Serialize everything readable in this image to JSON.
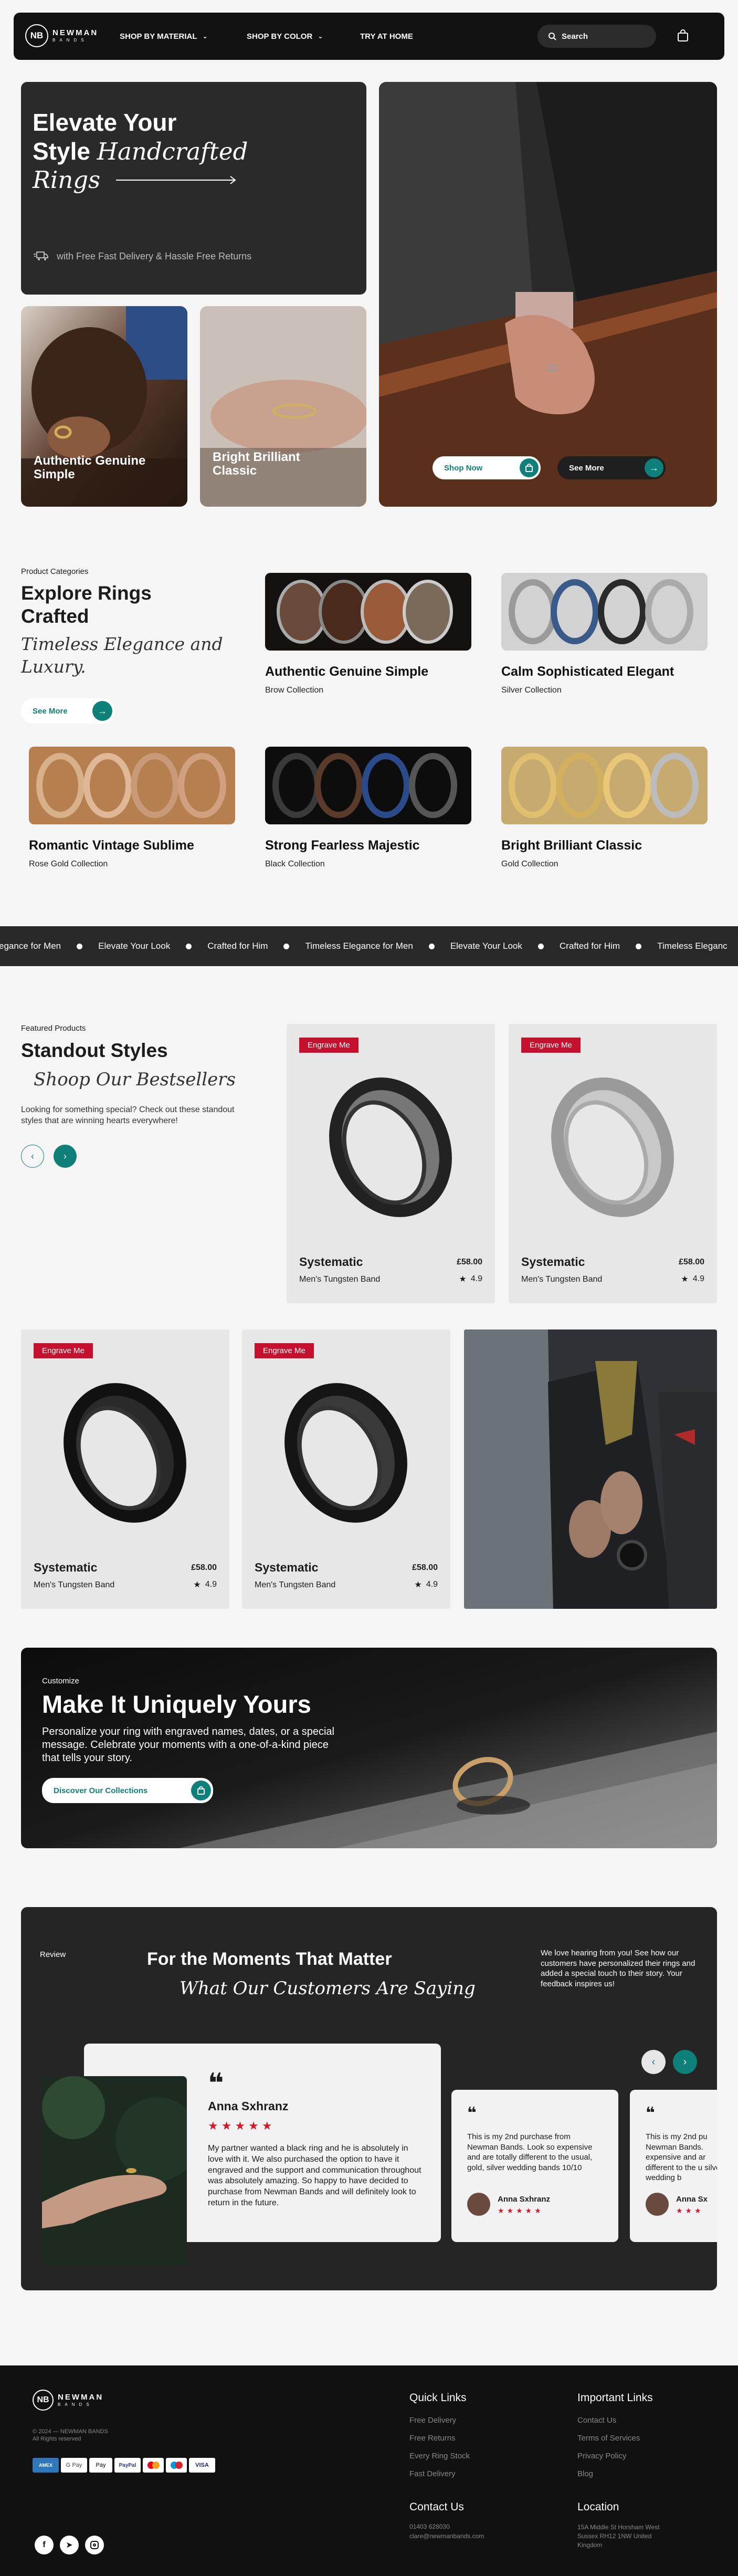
{
  "header": {
    "brand_initials": "NB",
    "brand_name": "NEWMAN",
    "brand_sub": "BANDS",
    "nav": [
      "SHOP BY MATERIAL",
      "SHOP BY COLOR",
      "TRY AT HOME"
    ],
    "search_placeholder": "Search"
  },
  "hero": {
    "title_line1": "Elevate Your",
    "title_line2_bold": "Style",
    "title_line2_italic": "Handcrafted",
    "title_line3_italic": "Rings",
    "delivery_text": "with Free Fast Delivery & Hassle Free Returns",
    "card1_label": "Authentic Genuine Simple",
    "card2_label": "Bright Brilliant Classic",
    "shop_now": "Shop Now",
    "see_more": "See More"
  },
  "categories": {
    "eyebrow": "Product Categories",
    "title": "Explore Rings Crafted",
    "subtitle": "Timeless Elegance and Luxury.",
    "see_more": "See More",
    "items": [
      {
        "title": "Authentic Genuine Simple",
        "sub": "Brow Collection"
      },
      {
        "title": "Calm Sophisticated Elegant",
        "sub": "Silver Collection"
      },
      {
        "title": "Romantic Vintage Sublime",
        "sub": "Rose Gold Collection"
      },
      {
        "title": "Strong Fearless Majestic",
        "sub": "Black Collection"
      },
      {
        "title": "Bright Brilliant Classic",
        "sub": "Gold Collection"
      }
    ]
  },
  "marquee": [
    "egance for Men",
    "Elevate Your Look",
    "Crafted for Him",
    "Timeless Elegance for Men",
    "Elevate Your Look",
    "Crafted for Him",
    "Timeless Eleganc"
  ],
  "featured": {
    "eyebrow": "Featured Products",
    "title": "Standout Styles",
    "subtitle": "Shoop Our Bestsellers",
    "description": "Looking for something special? Check out these standout styles that are winning hearts everywhere!",
    "products": [
      {
        "badge": "Engrave Me",
        "name": "Systematic",
        "price": "£58.00",
        "type": "Men's Tungsten Band",
        "rating": "4.9"
      },
      {
        "badge": "Engrave Me",
        "name": "Systematic",
        "price": "£58.00",
        "type": "Men's Tungsten Band",
        "rating": "4.9"
      },
      {
        "badge": "Engrave Me",
        "name": "Systematic",
        "price": "£58.00",
        "type": "Men's Tungsten Band",
        "rating": "4.9"
      },
      {
        "badge": "Engrave Me",
        "name": "Systematic",
        "price": "£58.00",
        "type": "Men's Tungsten Band",
        "rating": "4.9"
      }
    ]
  },
  "customize": {
    "eyebrow": "Customize",
    "title": "Make It Uniquely Yours",
    "text": "Personalize your ring with engraved names, dates, or a special message. Celebrate your moments with a one-of-a-kind piece that tells your story.",
    "button": "Discover Our Collections"
  },
  "reviews": {
    "eyebrow": "Review",
    "title": "For the Moments That Matter",
    "subtitle": "What Our Customers Are Saying",
    "intro": "We love hearing from you! See how our customers have personalized their rings and added a special touch to their story. Your feedback inspires us!",
    "main": {
      "name": "Anna Sxhranz",
      "stars": "★★★★★",
      "text": "My partner wanted a black ring and he is absolutely in love with it. We also purchased the option to have it engraved and the support and communication throughout was absolutely amazing. So happy to have decided to purchase from Newman Bands and will definitely look to return in the future."
    },
    "small1": {
      "text": "This is my 2nd purchase from Newman Bands. Look so expensive and are totally different to the usual, gold, silver wedding bands 10/10",
      "name": "Anna Sxhranz",
      "stars": "★★★★★"
    },
    "small2": {
      "text": "This is my 2nd pu Newman Bands. expensive and ar different to the u silver wedding b",
      "name": "Anna Sx",
      "stars": "★★★"
    }
  },
  "footer": {
    "brand_initials": "NB",
    "brand_name": "NEWMAN",
    "brand_sub": "BANDS",
    "copyright": "© 2024 — NEWMAN BANDS",
    "rights": "All Rights reserved",
    "payments": [
      "AMEX",
      "G Pay",
      "Pay",
      "PayPal",
      "",
      "",
      "VISA"
    ],
    "quick_links_title": "Quick Links",
    "quick_links": [
      "Free Delivery",
      "Free Returns",
      "Every Ring Stock",
      "Fast Delivery"
    ],
    "important_title": "Important Links",
    "important_links": [
      "Contact Us",
      "Terms of Services",
      "Privacy Policy",
      "Blog"
    ],
    "contact_title": "Contact Us",
    "phone": "01403 628030",
    "email": "clare@newmanbands.com",
    "location_title": "Location",
    "address": "15A Middle St Horsham West Sussex RH12 1NW United Kingdom"
  },
  "colors": {
    "accent": "#0f7f79",
    "badge": "#c5112d",
    "dark": "#121212"
  }
}
